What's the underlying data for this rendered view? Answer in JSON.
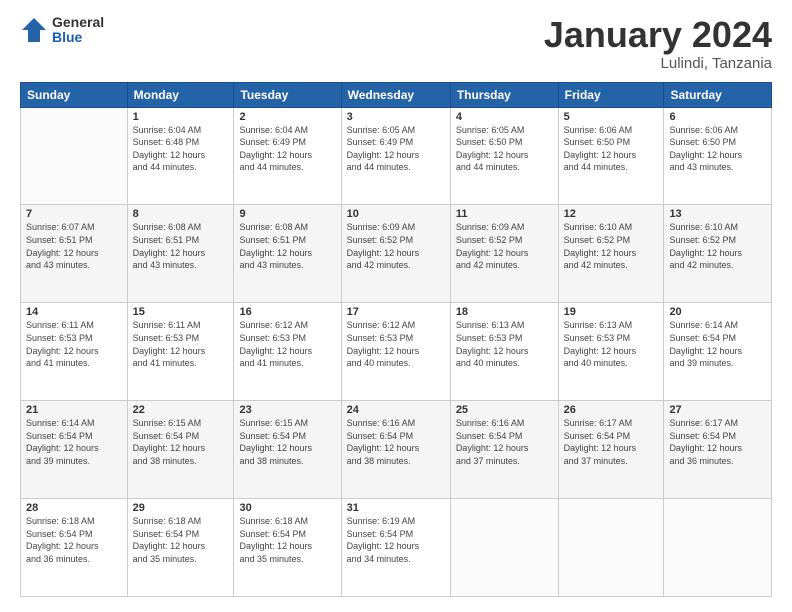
{
  "logo": {
    "general": "General",
    "blue": "Blue"
  },
  "header": {
    "month": "January 2024",
    "location": "Lulindi, Tanzania"
  },
  "weekdays": [
    "Sunday",
    "Monday",
    "Tuesday",
    "Wednesday",
    "Thursday",
    "Friday",
    "Saturday"
  ],
  "weeks": [
    [
      {
        "day": "",
        "sunrise": "",
        "sunset": "",
        "daylight": ""
      },
      {
        "day": "1",
        "sunrise": "6:04 AM",
        "sunset": "6:48 PM",
        "dh": "12 hours",
        "dm": "and 44 minutes."
      },
      {
        "day": "2",
        "sunrise": "6:04 AM",
        "sunset": "6:49 PM",
        "dh": "12 hours",
        "dm": "and 44 minutes."
      },
      {
        "day": "3",
        "sunrise": "6:05 AM",
        "sunset": "6:49 PM",
        "dh": "12 hours",
        "dm": "and 44 minutes."
      },
      {
        "day": "4",
        "sunrise": "6:05 AM",
        "sunset": "6:50 PM",
        "dh": "12 hours",
        "dm": "and 44 minutes."
      },
      {
        "day": "5",
        "sunrise": "6:06 AM",
        "sunset": "6:50 PM",
        "dh": "12 hours",
        "dm": "and 44 minutes."
      },
      {
        "day": "6",
        "sunrise": "6:06 AM",
        "sunset": "6:50 PM",
        "dh": "12 hours",
        "dm": "and 43 minutes."
      }
    ],
    [
      {
        "day": "7",
        "sunrise": "6:07 AM",
        "sunset": "6:51 PM",
        "dh": "12 hours",
        "dm": "and 43 minutes."
      },
      {
        "day": "8",
        "sunrise": "6:08 AM",
        "sunset": "6:51 PM",
        "dh": "12 hours",
        "dm": "and 43 minutes."
      },
      {
        "day": "9",
        "sunrise": "6:08 AM",
        "sunset": "6:51 PM",
        "dh": "12 hours",
        "dm": "and 43 minutes."
      },
      {
        "day": "10",
        "sunrise": "6:09 AM",
        "sunset": "6:52 PM",
        "dh": "12 hours",
        "dm": "and 42 minutes."
      },
      {
        "day": "11",
        "sunrise": "6:09 AM",
        "sunset": "6:52 PM",
        "dh": "12 hours",
        "dm": "and 42 minutes."
      },
      {
        "day": "12",
        "sunrise": "6:10 AM",
        "sunset": "6:52 PM",
        "dh": "12 hours",
        "dm": "and 42 minutes."
      },
      {
        "day": "13",
        "sunrise": "6:10 AM",
        "sunset": "6:52 PM",
        "dh": "12 hours",
        "dm": "and 42 minutes."
      }
    ],
    [
      {
        "day": "14",
        "sunrise": "6:11 AM",
        "sunset": "6:53 PM",
        "dh": "12 hours",
        "dm": "and 41 minutes."
      },
      {
        "day": "15",
        "sunrise": "6:11 AM",
        "sunset": "6:53 PM",
        "dh": "12 hours",
        "dm": "and 41 minutes."
      },
      {
        "day": "16",
        "sunrise": "6:12 AM",
        "sunset": "6:53 PM",
        "dh": "12 hours",
        "dm": "and 41 minutes."
      },
      {
        "day": "17",
        "sunrise": "6:12 AM",
        "sunset": "6:53 PM",
        "dh": "12 hours",
        "dm": "and 40 minutes."
      },
      {
        "day": "18",
        "sunrise": "6:13 AM",
        "sunset": "6:53 PM",
        "dh": "12 hours",
        "dm": "and 40 minutes."
      },
      {
        "day": "19",
        "sunrise": "6:13 AM",
        "sunset": "6:53 PM",
        "dh": "12 hours",
        "dm": "and 40 minutes."
      },
      {
        "day": "20",
        "sunrise": "6:14 AM",
        "sunset": "6:54 PM",
        "dh": "12 hours",
        "dm": "and 39 minutes."
      }
    ],
    [
      {
        "day": "21",
        "sunrise": "6:14 AM",
        "sunset": "6:54 PM",
        "dh": "12 hours",
        "dm": "and 39 minutes."
      },
      {
        "day": "22",
        "sunrise": "6:15 AM",
        "sunset": "6:54 PM",
        "dh": "12 hours",
        "dm": "and 38 minutes."
      },
      {
        "day": "23",
        "sunrise": "6:15 AM",
        "sunset": "6:54 PM",
        "dh": "12 hours",
        "dm": "and 38 minutes."
      },
      {
        "day": "24",
        "sunrise": "6:16 AM",
        "sunset": "6:54 PM",
        "dh": "12 hours",
        "dm": "and 38 minutes."
      },
      {
        "day": "25",
        "sunrise": "6:16 AM",
        "sunset": "6:54 PM",
        "dh": "12 hours",
        "dm": "and 37 minutes."
      },
      {
        "day": "26",
        "sunrise": "6:17 AM",
        "sunset": "6:54 PM",
        "dh": "12 hours",
        "dm": "and 37 minutes."
      },
      {
        "day": "27",
        "sunrise": "6:17 AM",
        "sunset": "6:54 PM",
        "dh": "12 hours",
        "dm": "and 36 minutes."
      }
    ],
    [
      {
        "day": "28",
        "sunrise": "6:18 AM",
        "sunset": "6:54 PM",
        "dh": "12 hours",
        "dm": "and 36 minutes."
      },
      {
        "day": "29",
        "sunrise": "6:18 AM",
        "sunset": "6:54 PM",
        "dh": "12 hours",
        "dm": "and 35 minutes."
      },
      {
        "day": "30",
        "sunrise": "6:18 AM",
        "sunset": "6:54 PM",
        "dh": "12 hours",
        "dm": "and 35 minutes."
      },
      {
        "day": "31",
        "sunrise": "6:19 AM",
        "sunset": "6:54 PM",
        "dh": "12 hours",
        "dm": "and 34 minutes."
      },
      {
        "day": "",
        "sunrise": "",
        "sunset": "",
        "dh": "",
        "dm": ""
      },
      {
        "day": "",
        "sunrise": "",
        "sunset": "",
        "dh": "",
        "dm": ""
      },
      {
        "day": "",
        "sunrise": "",
        "sunset": "",
        "dh": "",
        "dm": ""
      }
    ]
  ],
  "labels": {
    "sunrise": "Sunrise:",
    "sunset": "Sunset:",
    "daylight": "Daylight:"
  }
}
